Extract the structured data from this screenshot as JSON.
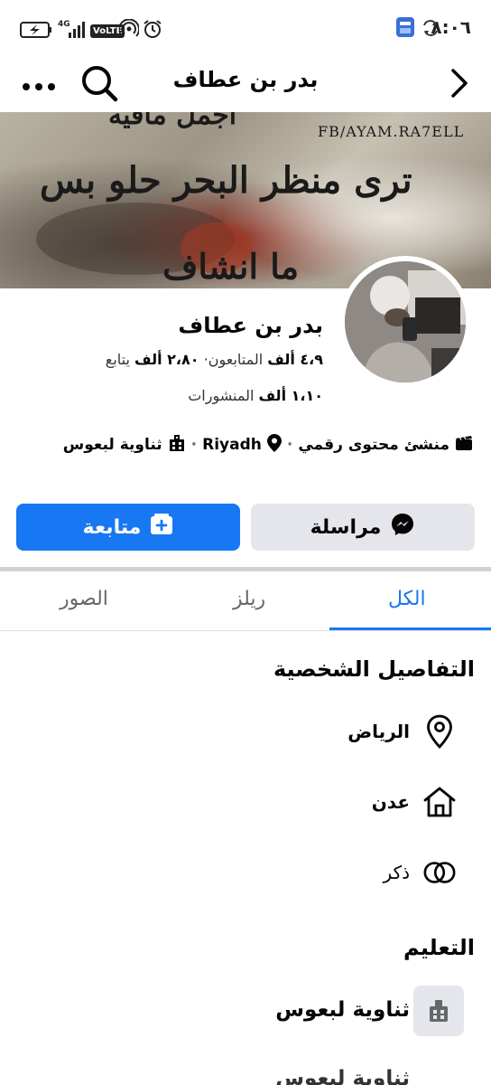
{
  "status_bar": {
    "time": "٨:٠٦",
    "network": "4G",
    "volte": "VoLTE",
    "icons": [
      "charging-icon",
      "signal-icon",
      "volte-icon",
      "hotspot-icon",
      "alarm-icon",
      "sync-icon",
      "app-notification-icon"
    ]
  },
  "header": {
    "title": "بدر بن عطاف",
    "icons": [
      "back-arrow-icon",
      "search-icon",
      "more-icon"
    ]
  },
  "cover": {
    "watermark": "FB/AYAM.RA7ELL",
    "line1": "ترى منظر البحر حلو بس",
    "line_top": "اجمل مافيه",
    "line_bottom": "ما انشاف"
  },
  "profile": {
    "name": "بدر بن عطاف",
    "followers_value": "٤،٩ ألف",
    "followers_label": "المتابعون",
    "following_value": "٢،٨٠ ألف",
    "following_label": "يتابع",
    "posts_value": "١،١٠ ألف",
    "posts_label": "المنشورات",
    "category": "منشئ محتوى رقمي",
    "location": "Riyadh",
    "school": "ثناوية لبعوس"
  },
  "buttons": {
    "message": "مراسلة",
    "follow": "متابعة"
  },
  "tabs": {
    "all": "الكل",
    "reels": "ريلز",
    "photos": "الصور"
  },
  "details": {
    "title": "التفاصيل الشخصية",
    "city": "الرياض",
    "hometown": "عدن",
    "gender": "ذكر"
  },
  "education": {
    "title": "التعليم",
    "school": "ثناوية لبعوس"
  },
  "colors": {
    "accent": "#1877f2",
    "secondary_button": "#e4e6eb",
    "muted_text": "#65676b"
  }
}
